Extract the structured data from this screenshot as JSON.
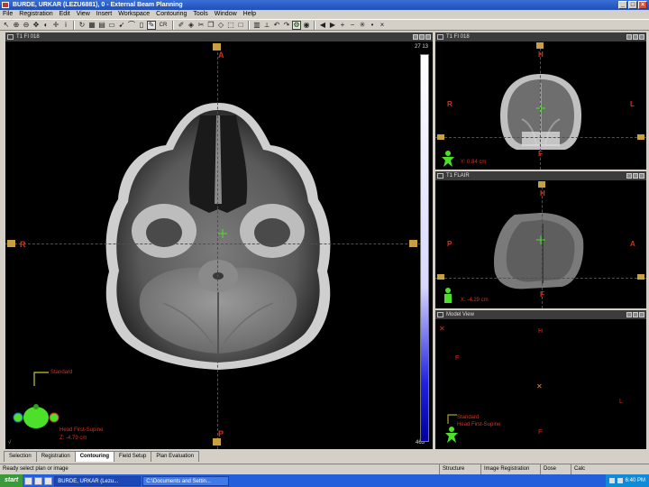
{
  "window": {
    "title": "BURDE, URKAR (LEZU6881), 0 - External Beam Planning",
    "controls": [
      "_",
      "□",
      "×"
    ]
  },
  "menu": [
    "File",
    "Registration",
    "Edit",
    "View",
    "Insert",
    "Workspace",
    "Contouring",
    "Tools",
    "Window",
    "Help"
  ],
  "toolbar": {
    "tools": [
      "arrow-icon",
      "zoom-in-icon",
      "zoom-out-icon",
      "pan-icon",
      "window-level-icon",
      "crosshair-icon",
      "info-icon",
      "refresh-icon",
      "grid-icon",
      "layout-icon",
      "ruler-icon",
      "pointer-icon",
      "draw-icon",
      "eraser-icon",
      "pencil-icon",
      "brush-icon",
      "fill-icon",
      "cut-icon",
      "copy-icon",
      "shape-icon",
      "select-icon",
      "box-icon",
      "palette-icon",
      "measure-icon",
      "undo-icon",
      "redo-icon",
      "settings-icon",
      "camera-icon",
      "arrow-left-icon",
      "arrow-right-icon",
      "plus-icon",
      "minus-icon",
      "star-icon",
      "dot-icon",
      "close-icon"
    ],
    "cbx_label": "CR"
  },
  "main_view": {
    "header": "T1 FI 018",
    "labels": {
      "top": "A",
      "bottom": "P",
      "left": "R"
    },
    "corner_top": "27 13",
    "corner_bottom": "463",
    "structure_label": "Standard",
    "orientation": "Head First-Supine",
    "z_coord": "Z: -4.79 cm",
    "check": "√"
  },
  "coronal_view": {
    "header": "T1 FI 018",
    "labels": {
      "top": "H",
      "bottom": "F",
      "left": "R",
      "right": "L"
    },
    "coord": "Y: 0.84 cm"
  },
  "sagittal_view": {
    "header": "T1 FLAIR",
    "labels": {
      "top": "H",
      "bottom": "F",
      "left": "P",
      "right": "A"
    },
    "coord": "X: -4.29 cm"
  },
  "model_view": {
    "header": "Model View",
    "labels": {
      "h": "H",
      "f_left": "F",
      "l": "L",
      "f_bottom": "F"
    },
    "structure_label": "Standard",
    "orientation": "Head First-Supine"
  },
  "tabs": [
    "Selection",
    "Registration",
    "Contouring",
    "Field Setup",
    "Plan Evaluation"
  ],
  "active_tab": "Contouring",
  "status": {
    "message": "Ready  select plan or image",
    "cells": [
      "Structure",
      "Image Registration",
      "Dose",
      "Calc"
    ]
  },
  "taskbar": {
    "start": "start",
    "tasks": [
      "BURDE, URKAR (Lezu...",
      "C:\\Documents and Settin..."
    ],
    "clock": "6:40 PM"
  }
}
